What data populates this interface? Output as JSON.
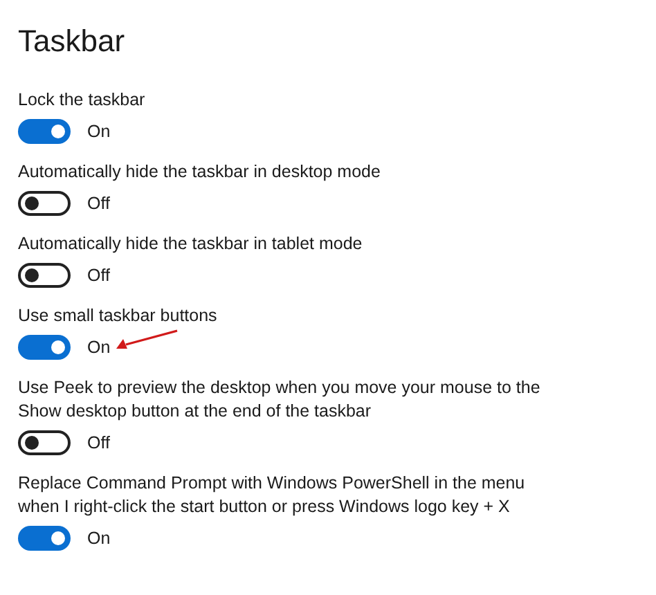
{
  "title": "Taskbar",
  "settings": [
    {
      "label": "Lock the taskbar",
      "on": true,
      "state_text": "On"
    },
    {
      "label": "Automatically hide the taskbar in desktop mode",
      "on": false,
      "state_text": "Off"
    },
    {
      "label": "Automatically hide the taskbar in tablet mode",
      "on": false,
      "state_text": "Off"
    },
    {
      "label": "Use small taskbar buttons",
      "on": true,
      "state_text": "On"
    },
    {
      "label": "Use Peek to preview the desktop when you move your mouse to the Show desktop button at the end of the taskbar",
      "on": false,
      "state_text": "Off"
    },
    {
      "label": "Replace Command Prompt with Windows PowerShell in the menu when I right-click the start button or press Windows logo key + X",
      "on": true,
      "state_text": "On"
    }
  ]
}
